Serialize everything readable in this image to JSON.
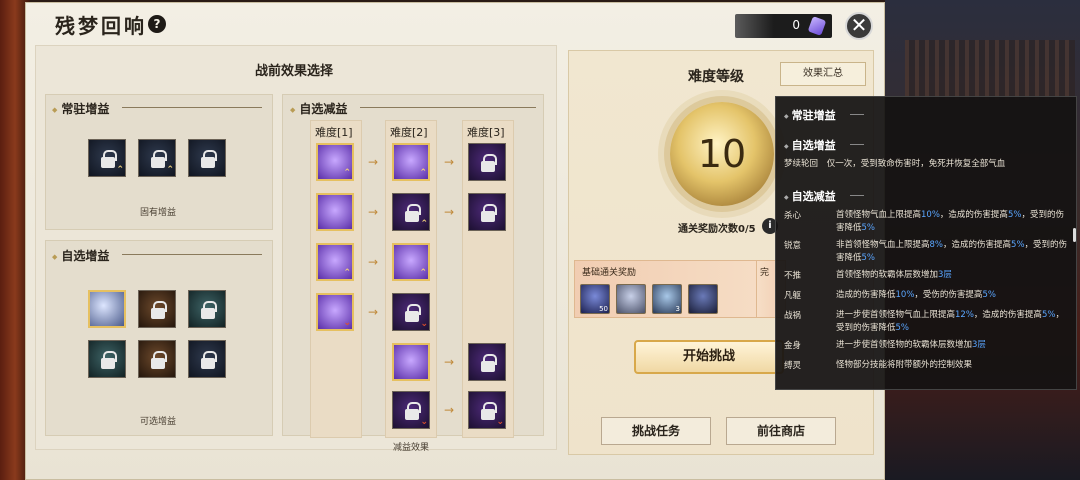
{
  "title": "残梦回响",
  "help_icon": "?",
  "currency": {
    "amount": "0",
    "icon": "purple-gem-icon"
  },
  "close_glyph": "✕",
  "left": {
    "section_title": "战前效果选择",
    "fixed_buffs": {
      "header": "常驻增益",
      "footer": "固有增益"
    },
    "optional_buffs": {
      "header": "自选增益",
      "footer": "可选增益"
    },
    "debuffs": {
      "header": "自选减益",
      "columns": [
        "难度[1]",
        "难度[2]",
        "难度[3]"
      ],
      "footer": "减益效果"
    }
  },
  "right": {
    "difficulty_title": "难度等级",
    "summary_button": "效果汇总",
    "difficulty_level": "10",
    "clear_count": "通关奖励次数0/5",
    "info_glyph": "i",
    "base_reward_label": "基础通关奖励",
    "perfect_reward_label": "完",
    "rewards": [
      {
        "qty": "50"
      },
      {
        "qty": ""
      },
      {
        "qty": "3"
      },
      {
        "qty": ""
      }
    ],
    "start_button": "开始挑战",
    "task_button": "挑战任务",
    "shop_button": "前往商店"
  },
  "tooltip": {
    "fixed_header": "常驻增益",
    "optional_header": "自选增益",
    "optional_row": {
      "name": "梦续轮回",
      "desc": "仅一次，受到致命伤害时，免死并恢复全部气血"
    },
    "debuff_header": "自选减益",
    "debuff_rows": [
      {
        "name": "杀心",
        "desc_a": "首领怪物气血上限提高",
        "v1": "10%",
        "desc_b": "，造成的伤害提高",
        "v2": "5%",
        "desc_c": "，受到的伤害降低",
        "v3": "5%"
      },
      {
        "name": "锐意",
        "desc_a": "非首领怪物气血上限提高",
        "v1": "8%",
        "desc_b": "，造成的伤害提高",
        "v2": "5%",
        "desc_c": "，受到的伤害降低",
        "v3": "5%"
      },
      {
        "name": "不推",
        "desc_a": "首领怪物的软霸体层数增加",
        "v1": "3层",
        "desc_b": "",
        "v2": "",
        "desc_c": "",
        "v3": ""
      },
      {
        "name": "凡躯",
        "desc_a": "造成的伤害降低",
        "v1": "10%",
        "desc_b": "，受伤的伤害提高",
        "v2": "5%",
        "desc_c": "",
        "v3": ""
      },
      {
        "name": "战祸",
        "desc_a": "进一步使首领怪物气血上限提高",
        "v1": "12%",
        "desc_b": "，造成的伤害提高",
        "v2": "5%",
        "desc_c": "，受到的伤害降低",
        "v3": "5%"
      },
      {
        "name": "金身",
        "desc_a": "进一步使首领怪物的软霸体层数增加",
        "v1": "3层",
        "desc_b": "",
        "v2": "",
        "desc_c": "",
        "v3": ""
      },
      {
        "name": "缚灵",
        "desc_a": "怪物部分技能将附带额外的控制效果",
        "v1": "",
        "desc_b": "",
        "v2": "",
        "desc_c": "",
        "v3": ""
      }
    ]
  },
  "colors": {
    "accent_gold": "#e6c060",
    "highlight_blue": "#5aa6ff",
    "panel_bg": "#f3efe4"
  }
}
